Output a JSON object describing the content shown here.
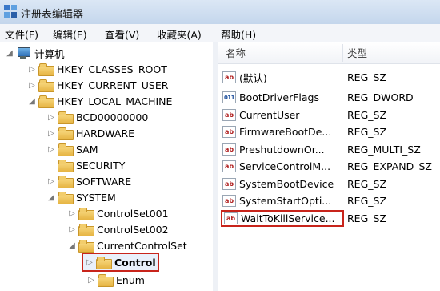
{
  "window": {
    "title": "注册表编辑器"
  },
  "menu": [
    "文件(F)",
    "编辑(E)",
    "查看(V)",
    "收藏夹(A)",
    "帮助(H)"
  ],
  "tree": {
    "root": "计算机",
    "nodes": [
      "HKEY_CLASSES_ROOT",
      "HKEY_CURRENT_USER",
      "HKEY_LOCAL_MACHINE",
      "BCD00000000",
      "HARDWARE",
      "SAM",
      "SECURITY",
      "SOFTWARE",
      "SYSTEM",
      "ControlSet001",
      "ControlSet002",
      "CurrentControlSet",
      "Control",
      "Enum"
    ]
  },
  "list": {
    "headers": {
      "name": "名称",
      "type": "类型"
    },
    "rows": [
      {
        "icon": "ab",
        "name": "(默认)",
        "type": "REG_SZ"
      },
      {
        "icon": "011",
        "name": "BootDriverFlags",
        "type": "REG_DWORD"
      },
      {
        "icon": "ab",
        "name": "CurrentUser",
        "type": "REG_SZ"
      },
      {
        "icon": "ab",
        "name": "FirmwareBootDe...",
        "type": "REG_SZ"
      },
      {
        "icon": "ab",
        "name": "PreshutdownOr...",
        "type": "REG_MULTI_SZ"
      },
      {
        "icon": "ab",
        "name": "ServiceControlM...",
        "type": "REG_EXPAND_SZ"
      },
      {
        "icon": "ab",
        "name": "SystemBootDevice",
        "type": "REG_SZ"
      },
      {
        "icon": "ab",
        "name": "SystemStartOpti...",
        "type": "REG_SZ"
      },
      {
        "icon": "ab",
        "name": "WaitToKillService...",
        "type": "REG_SZ"
      }
    ]
  },
  "colors": {
    "highlight": "#c8241b",
    "title_bar": "#c4d6ec"
  }
}
